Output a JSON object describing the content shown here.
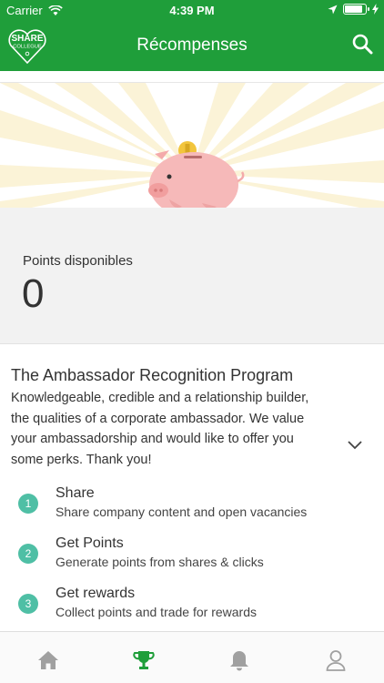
{
  "status": {
    "carrier": "Carrier",
    "time": "4:39 PM",
    "battery_level": 0.9
  },
  "header": {
    "title": "Récompenses",
    "logo_top": "SHARE",
    "logo_bottom": "COLLEGUE"
  },
  "points": {
    "label": "Points disponibles",
    "value": "0"
  },
  "program": {
    "title": "The Ambassador Recognition Program",
    "description": "Knowledgeable, credible and a relationship builder, the qualities of a corporate ambassador. We value your ambassadorship and would like to offer you some perks. Thank you!"
  },
  "steps": [
    {
      "num": "1",
      "title": "Share",
      "desc": "Share company content and open vacancies"
    },
    {
      "num": "2",
      "title": "Get Points",
      "desc": "Generate points from shares & clicks"
    },
    {
      "num": "3",
      "title": "Get rewards",
      "desc": "Collect points and trade for rewards"
    }
  ],
  "tabs": {
    "active": "rewards",
    "items": [
      "home-icon",
      "trophy-icon",
      "bell-icon",
      "user-icon"
    ]
  },
  "colors": {
    "brand": "#1f9e3a",
    "accent": "#4fbfa5"
  }
}
